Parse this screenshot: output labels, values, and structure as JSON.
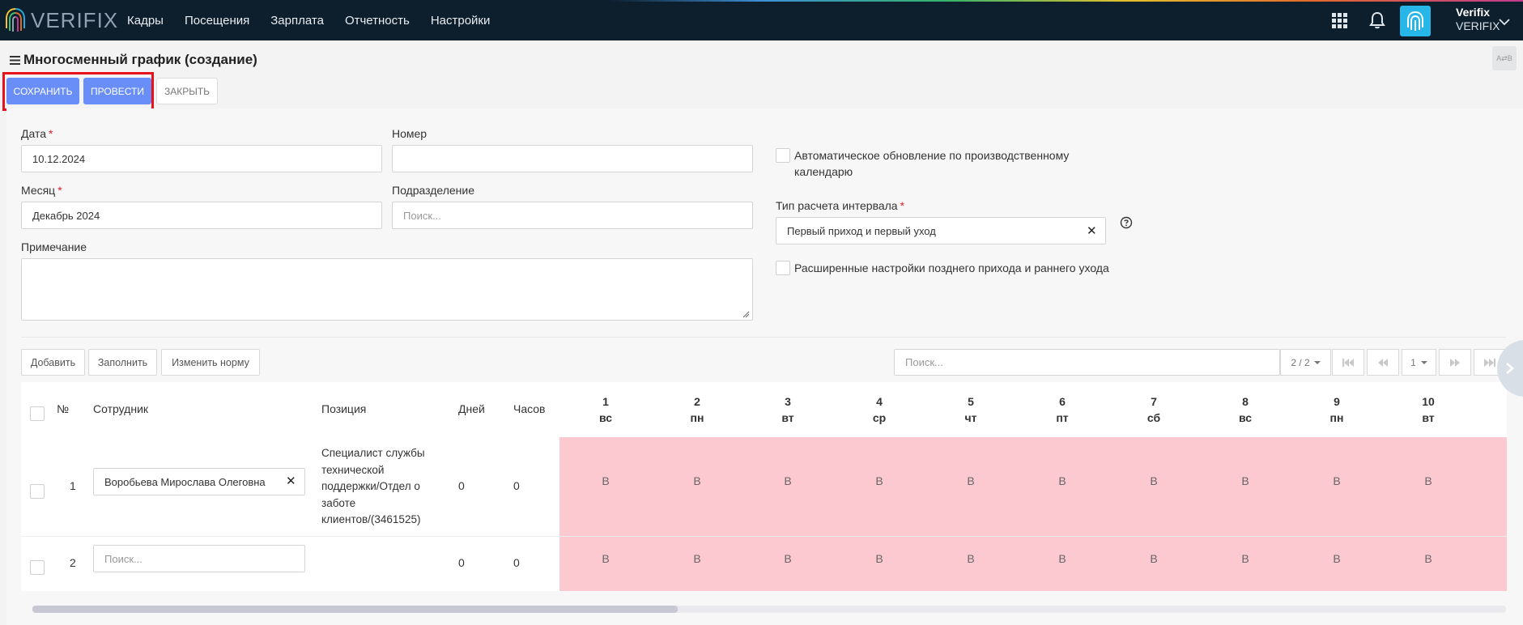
{
  "topbar": {
    "logo_text": "VERIFIX",
    "nav": [
      "Кадры",
      "Посещения",
      "Зарплата",
      "Отчетность",
      "Настройки"
    ],
    "user_name": "Verifix",
    "user_org": "VERIFIX",
    "icons": [
      "apps-grid-icon",
      "bell-icon",
      "fingerprint-icon",
      "chevron-down-icon"
    ]
  },
  "page": {
    "title": "Многосменный график (создание)",
    "corner_button": "A⇄B"
  },
  "actions": {
    "save": "СОХРАНИТЬ",
    "post": "ПРОВЕСТИ",
    "close": "ЗАКРЫТЬ"
  },
  "form": {
    "date_label": "Дата",
    "date_value": "10.12.2024",
    "number_label": "Номер",
    "number_value": "",
    "month_label": "Месяц",
    "month_value": "Декабрь 2024",
    "division_label": "Подразделение",
    "division_placeholder": "Поиск...",
    "note_label": "Примечание",
    "note_value": "",
    "auto_update_label": "Автоматическое обновление по производственному календарю",
    "interval_label": "Тип расчета интервала",
    "interval_value": "Первый приход и первый уход",
    "extended_label": "Расширенные настройки позднего прихода и раннего ухода",
    "required_mark": "*",
    "clear_mark": "✕"
  },
  "table_toolbar": {
    "add": "Добавить",
    "fill": "Заполнить",
    "change_norm": "Изменить норму",
    "search_placeholder": "Поиск...",
    "page_info": "2 / 2",
    "page_number": "1"
  },
  "table": {
    "headers": {
      "num": "№",
      "employee": "Сотрудник",
      "position": "Позиция",
      "days": "Дней",
      "hours": "Часов"
    },
    "days": [
      {
        "n": "1",
        "wd": "вс"
      },
      {
        "n": "2",
        "wd": "пн"
      },
      {
        "n": "3",
        "wd": "вт"
      },
      {
        "n": "4",
        "wd": "ср"
      },
      {
        "n": "5",
        "wd": "чт"
      },
      {
        "n": "6",
        "wd": "пт"
      },
      {
        "n": "7",
        "wd": "сб"
      },
      {
        "n": "8",
        "wd": "вс"
      },
      {
        "n": "9",
        "wd": "пн"
      },
      {
        "n": "10",
        "wd": "вт"
      }
    ],
    "rows": [
      {
        "num": "1",
        "employee": "Воробьева Мирослава Олеговна",
        "position": "Специалист службы технической поддержки/Отдел о заботе клиентов/(3461525)",
        "days": "0",
        "hours": "0",
        "cells": [
          "В",
          "В",
          "В",
          "В",
          "В",
          "В",
          "В",
          "В",
          "В",
          "В"
        ]
      },
      {
        "num": "2",
        "employee_placeholder": "Поиск...",
        "position": "",
        "days": "0",
        "hours": "0",
        "cells": [
          "В",
          "В",
          "В",
          "В",
          "В",
          "В",
          "В",
          "В",
          "В",
          "В"
        ]
      }
    ]
  },
  "colors": {
    "topbar": "#0d1e2d",
    "primary_button": "#6a8ef7",
    "weekend_cell": "#fdc9d1",
    "highlight": "#e8121c"
  }
}
